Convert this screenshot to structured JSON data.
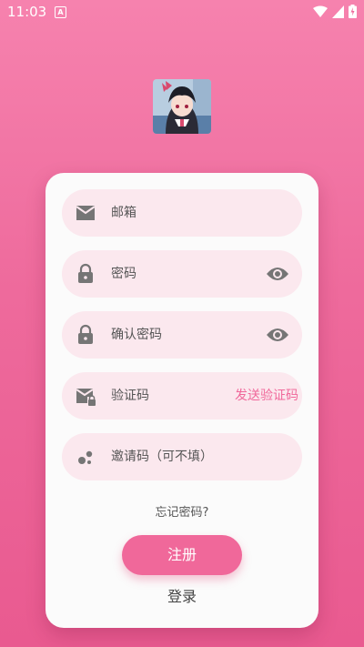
{
  "status_bar": {
    "time": "11:03",
    "notification_icon": "a-notification-icon"
  },
  "form": {
    "email_label": "邮箱",
    "password_label": "密码",
    "confirm_password_label": "确认密码",
    "code_label": "验证码",
    "send_code_label": "发送验证码",
    "invite_label": "邀请码（可不填）"
  },
  "forgot_password": "忘记密码?",
  "register_label": "注册",
  "login_label": "登录",
  "colors": {
    "accent": "#F0689A",
    "field_bg": "#FBE8EE",
    "icon_gray": "#757575"
  }
}
